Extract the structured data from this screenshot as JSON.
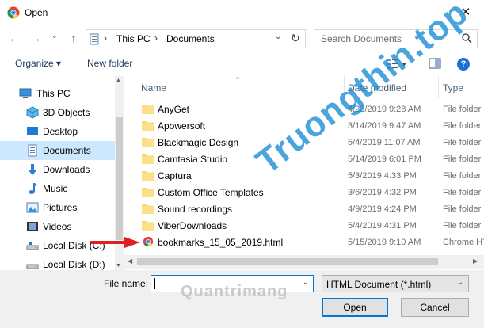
{
  "window": {
    "title": "Open",
    "close_glyph": "✕"
  },
  "nav": {
    "back_glyph": "←",
    "forward_glyph": "→",
    "recent_glyph": "⌄",
    "up_glyph": "↑",
    "breadcrumbs": [
      "This PC",
      "Documents"
    ],
    "separator": "›",
    "dropdown_glyph": "⌄",
    "refresh_glyph": "↻"
  },
  "search": {
    "placeholder": "Search Documents"
  },
  "toolbar": {
    "organize_label": "Organize ▾",
    "new_folder_label": "New folder",
    "help_glyph": "?"
  },
  "sidebar": {
    "items": [
      {
        "label": "This PC",
        "icon": "pc-icon"
      },
      {
        "label": "3D Objects",
        "icon": "cube-icon"
      },
      {
        "label": "Desktop",
        "icon": "desktop-icon"
      },
      {
        "label": "Documents",
        "icon": "documents-icon"
      },
      {
        "label": "Downloads",
        "icon": "download-icon"
      },
      {
        "label": "Music",
        "icon": "music-icon"
      },
      {
        "label": "Pictures",
        "icon": "pictures-icon"
      },
      {
        "label": "Videos",
        "icon": "videos-icon"
      },
      {
        "label": "Local Disk (C:)",
        "icon": "disk-icon"
      },
      {
        "label": "Local Disk (D:)",
        "icon": "disk-icon"
      }
    ]
  },
  "columns": {
    "name": "Name",
    "date": "Date modified",
    "type": "Type"
  },
  "files": [
    {
      "name": "AnyGet",
      "date": "4/23/2019 9:28 AM",
      "type": "File folder",
      "icon": "folder-icon"
    },
    {
      "name": "Apowersoft",
      "date": "3/14/2019 9:47 AM",
      "type": "File folder",
      "icon": "folder-icon"
    },
    {
      "name": "Blackmagic Design",
      "date": "5/4/2019 11:07 AM",
      "type": "File folder",
      "icon": "folder-icon"
    },
    {
      "name": "Camtasia Studio",
      "date": "5/14/2019 6:01 PM",
      "type": "File folder",
      "icon": "folder-icon"
    },
    {
      "name": "Captura",
      "date": "5/3/2019 4:33 PM",
      "type": "File folder",
      "icon": "folder-icon"
    },
    {
      "name": "Custom Office Templates",
      "date": "3/6/2019 4:32 PM",
      "type": "File folder",
      "icon": "folder-icon"
    },
    {
      "name": "Sound recordings",
      "date": "4/9/2019 4:24 PM",
      "type": "File folder",
      "icon": "folder-icon"
    },
    {
      "name": "ViberDownloads",
      "date": "5/4/2019 4:31 PM",
      "type": "File folder",
      "icon": "folder-icon"
    },
    {
      "name": "bookmarks_15_05_2019.html",
      "date": "5/15/2019 9:10 AM",
      "type": "Chrome HTML Document",
      "icon": "chrome-icon"
    }
  ],
  "bottom": {
    "file_name_label": "File name:",
    "file_name_value": "",
    "file_type_value": "HTML Document (*.html)",
    "open_label": "Open",
    "cancel_label": "Cancel"
  },
  "watermarks": {
    "diagonal": "Truongthin.top",
    "bottom": "Quantrimang"
  },
  "colors": {
    "selection": "#cce8ff",
    "accent": "#0078d7",
    "folder": "#f8d775",
    "arrow": "#e02020"
  }
}
